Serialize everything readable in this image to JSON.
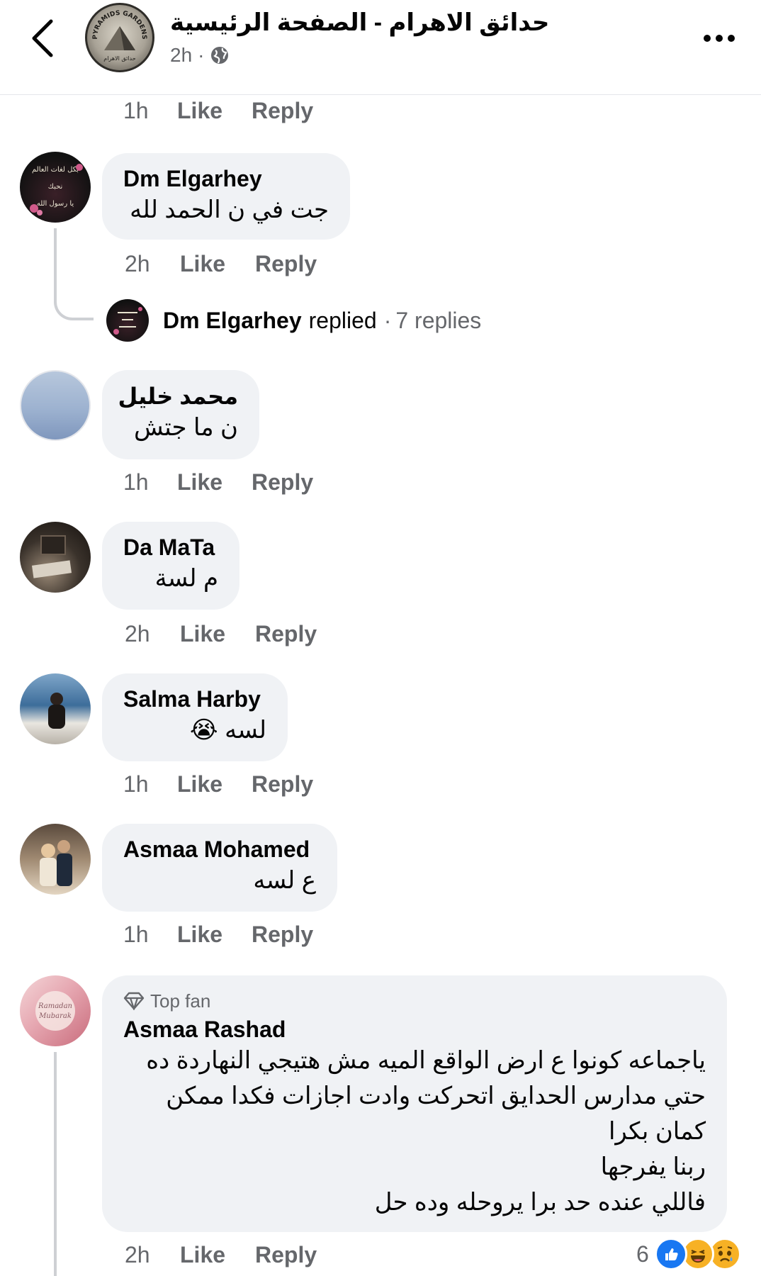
{
  "header": {
    "title": "حدائق الاهرام - الصفحة الرئيسية",
    "time": "2h",
    "separator": "·",
    "privacy_icon": "globe-icon",
    "logo_arc_text": "PYRAMIDS GARDENS",
    "logo_bottom_text": "حدائق الاهرام"
  },
  "comment0_actions": {
    "time": "1h",
    "like": "Like",
    "reply": "Reply"
  },
  "comments": [
    {
      "name": "Dm Elgarhey",
      "text": "جت في ن الحمد لله",
      "time": "2h",
      "like": "Like",
      "reply": "Reply",
      "avatar_text": [
        "بكل لغات العالم",
        "نحبك",
        "يا رسول الله"
      ],
      "replies_summary": {
        "name": "Dm Elgarhey",
        "action": "replied",
        "separator": "·",
        "count": "7 replies"
      }
    },
    {
      "name": "محمد خليل",
      "text": "ن ما جتش",
      "time": "1h",
      "like": "Like",
      "reply": "Reply"
    },
    {
      "name": "Da MaTa",
      "text": "م لسة",
      "time": "2h",
      "like": "Like",
      "reply": "Reply"
    },
    {
      "name": "Salma Harby",
      "text": "لسه",
      "emoji": "😭",
      "time": "1h",
      "like": "Like",
      "reply": "Reply"
    },
    {
      "name": "Asmaa Mohamed",
      "text": "ع لسه",
      "time": "1h",
      "like": "Like",
      "reply": "Reply"
    },
    {
      "badge": "Top fan",
      "badge_icon": "diamond-icon",
      "name": "Asmaa Rashad",
      "lines": [
        "ياجماعه كونوا ع ارض الواقع الميه مش هتيجي النهاردة ده",
        "حتي مدارس الحدايق اتحركت وادت اجازات فكدا ممكن",
        "كمان بكرا",
        "ربنا يفرجها",
        "فاللي عنده حد برا يروحله وده حل"
      ],
      "avatar_text": [
        "Ramadan",
        "Mubarak"
      ],
      "time": "2h",
      "like": "Like",
      "reply": "Reply",
      "reactions": {
        "count": "6",
        "types": [
          "like-reaction-icon",
          "haha-reaction-icon",
          "sad-reaction-icon"
        ]
      }
    }
  ],
  "colors": {
    "bubble": "#f0f2f5",
    "secondary_text": "#65676b",
    "like_blue": "#1877f2",
    "reaction_yellow": "#f7b125"
  }
}
